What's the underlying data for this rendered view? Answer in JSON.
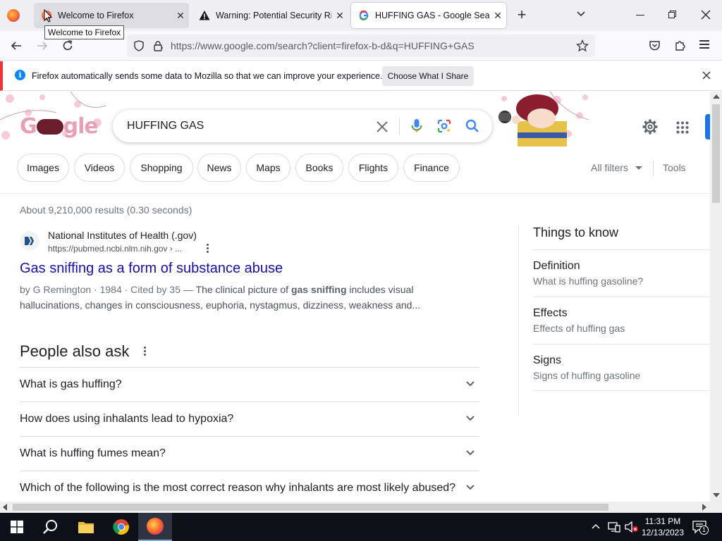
{
  "tabs": [
    {
      "title": "Welcome to Firefox",
      "close": "✕"
    },
    {
      "title": "Warning: Potential Security Risk Ahead",
      "close": "✕"
    },
    {
      "title": "HUFFING GAS - Google Search",
      "close": "✕"
    }
  ],
  "tooltip": "Welcome to Firefox",
  "url": "https://www.google.com/search?client=firefox-b-d&q=HUFFING+GAS",
  "notification": {
    "message": "Firefox automatically sends some data to Mozilla so that we can improve your experience.",
    "button": "Choose What I Share"
  },
  "search": {
    "query": "HUFFING GAS"
  },
  "filters": [
    "Images",
    "Videos",
    "Shopping",
    "News",
    "Maps",
    "Books",
    "Flights",
    "Finance"
  ],
  "all_filters": "All filters",
  "tools": "Tools",
  "stats": "About 9,210,000 results (0.30 seconds)",
  "result": {
    "site": "National Institutes of Health (.gov)",
    "url": "https://pubmed.ncbi.nlm.nih.gov › ...",
    "title": "Gas sniffing as a form of substance abuse",
    "meta": "by G Remington · 1984 · Cited by 35 — ",
    "snip1": "The clinical picture of ",
    "snip_bold": "gas sniffing",
    "snip2": " includes visual",
    "snip_line2": "hallucinations, changes in consciousness, euphoria, nystagmus, dizziness, weakness and..."
  },
  "paa": {
    "heading": "People also ask",
    "questions": [
      "What is gas huffing?",
      "How does using inhalants lead to hypoxia?",
      "What is huffing fumes mean?",
      "Which of the following is the most correct reason why inhalants are most likely abused?"
    ]
  },
  "things_to_know": {
    "heading": "Things to know",
    "items": [
      {
        "title": "Definition",
        "sub": "What is huffing gasoline?"
      },
      {
        "title": "Effects",
        "sub": "Effects of huffing gas"
      },
      {
        "title": "Signs",
        "sub": "Signs of huffing gasoline"
      }
    ]
  },
  "taskbar": {
    "time": "11:31 PM",
    "date": "12/13/2023",
    "notif_count": "1"
  },
  "colors": {
    "link": "#1a0dab",
    "google_blue": "#1a73e8",
    "taskbar": "#0d1117"
  }
}
